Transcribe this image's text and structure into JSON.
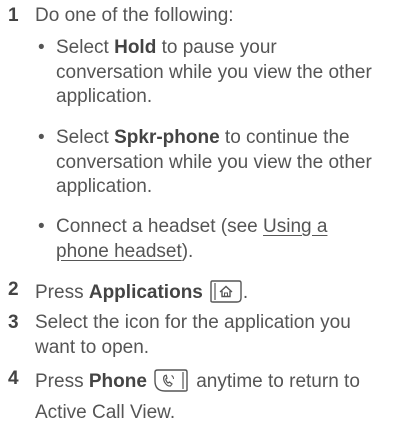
{
  "steps": [
    {
      "number": "1",
      "text": "Do one of the following:",
      "bullets": [
        {
          "dot": "•",
          "pre": "Select ",
          "bold": "Hold",
          "line1_rest": " to pause your",
          "line2": "conversation while you view the other",
          "line3": "application."
        },
        {
          "dot": "•",
          "pre": "Select ",
          "bold": "Spkr-phone",
          "line1_rest": " to continue the",
          "line2": "conversation while you view the other",
          "line3": "application."
        },
        {
          "dot": "•",
          "pre": "Connect a headset (see ",
          "link_line1": "Using a",
          "link_line2": "phone headset",
          "post": ")."
        }
      ]
    },
    {
      "number": "2",
      "pre": "Press ",
      "bold": "Applications",
      "icon": "applications-button-icon",
      "post": "."
    },
    {
      "number": "3",
      "line1": "Select the icon for the application you",
      "line2": "want to open."
    },
    {
      "number": "4",
      "pre": "Press ",
      "bold": "Phone",
      "icon": "phone-button-icon",
      "post": " anytime to return to",
      "line2": "Active Call View."
    }
  ]
}
